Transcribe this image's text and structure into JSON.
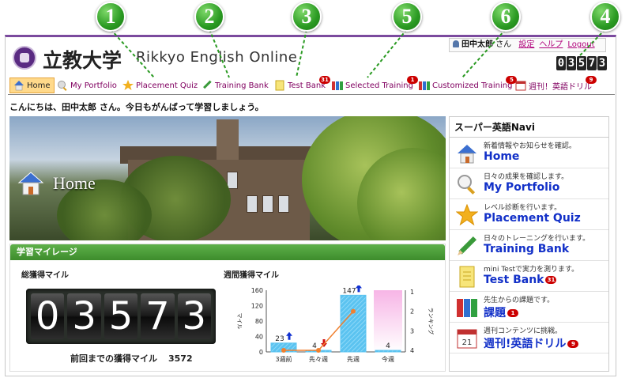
{
  "callouts": [
    "1",
    "2",
    "3",
    "5",
    "6",
    "4"
  ],
  "header": {
    "university": "立教大学",
    "site_name": "Rikkyo English Online"
  },
  "user": {
    "name": "田中太郎",
    "honorific": "さん",
    "settings": "設定",
    "help": "ヘルプ",
    "logout": "Logout"
  },
  "top_counter": "03573",
  "nav": {
    "home": "Home",
    "portfolio": "My Portfolio",
    "placement": "Placement Quiz",
    "training": "Training Bank",
    "test": "Test Bank",
    "test_badge": "31",
    "selected": "Selected Training",
    "selected_badge": "1",
    "customized": "Customized Training",
    "customized_badge": "5",
    "weekly": "週刊！英語ドリル",
    "weekly_badge": "9"
  },
  "greeting": "こんにちは、田中太郎 さん。今日もがんばって学習しましょう。",
  "hero": {
    "title": "Home"
  },
  "mileage": {
    "section_title": "学習マイレージ",
    "total_label": "総獲得マイル",
    "total_digits": [
      "0",
      "3",
      "5",
      "7",
      "3"
    ],
    "prev_label": "前回までの獲得マイル",
    "prev_value": "3572",
    "weekly_label": "週間獲得マイル"
  },
  "chart_data": {
    "type": "bar",
    "categories": [
      "3週前",
      "先々週",
      "先週",
      "今週"
    ],
    "series": [
      {
        "values": [
          23,
          4,
          147,
          4
        ]
      }
    ],
    "rank": [
      4,
      4,
      2,
      null
    ],
    "value_labels": [
      "23",
      "4",
      "147",
      "4"
    ],
    "trend": [
      "up",
      "down",
      "up",
      "none"
    ],
    "yticks_left": [
      "0",
      "40",
      "80",
      "120",
      "160"
    ],
    "ylim": [
      0,
      160
    ],
    "ylabel_left": "マイル",
    "yticks_right": [
      "1",
      "2",
      "3",
      "4"
    ],
    "ylabel_right": "ランキング",
    "colors": {
      "bar": "#5bc3f0",
      "rank_line": "#f08030",
      "highlight": "#f7b5e6",
      "up": "#1030d0",
      "down": "#d01010"
    }
  },
  "navi": {
    "title": "スーパー英語Navi",
    "items": [
      {
        "desc": "新着情報やお知らせを確認。",
        "label": "Home",
        "badge": ""
      },
      {
        "desc": "日々の成果を確認します。",
        "label": "My Portfolio",
        "badge": ""
      },
      {
        "desc": "レベル診断を行います。",
        "label": "Placement Quiz",
        "badge": ""
      },
      {
        "desc": "日々のトレーニングを行います。",
        "label": "Training Bank",
        "badge": ""
      },
      {
        "desc": "mini Testで実力を測ります。",
        "label": "Test Bank",
        "badge": "31"
      },
      {
        "desc": "先生からの課題です。",
        "label": "課題",
        "badge": "1"
      },
      {
        "desc": "週刊コンテンツに挑戦。",
        "label": "週刊!英語ドリル",
        "badge": "9"
      }
    ]
  }
}
